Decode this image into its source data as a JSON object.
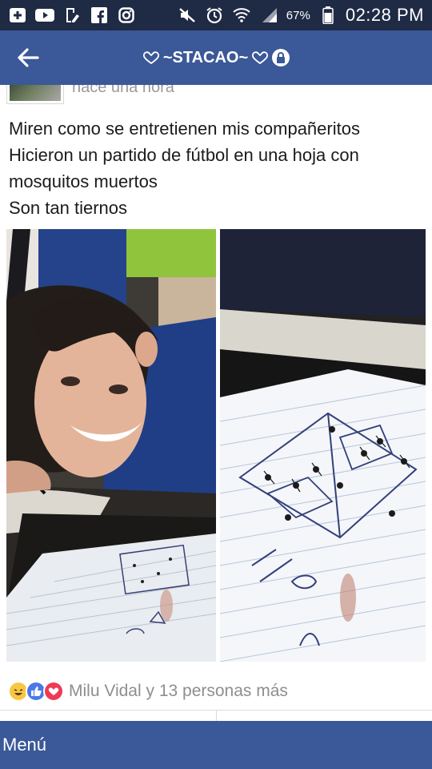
{
  "status_bar": {
    "time": "02:28 PM",
    "battery_percent": "67%",
    "icons_left": [
      "add-box-icon",
      "youtube-icon",
      "edit-doc-icon",
      "facebook-icon",
      "instagram-icon"
    ],
    "icons_right": [
      "mute-icon",
      "alarm-icon",
      "wifi-icon",
      "signal-icon",
      "battery-icon"
    ]
  },
  "app_bar": {
    "title": "~STACAO~",
    "back_icon": "arrow-left-icon",
    "lock_icon": "lock-icon"
  },
  "post": {
    "time": "hace una hora",
    "lines": [
      "Miren como se entretienen mis compañeritos",
      "Hicieron un partido de fútbol en una hoja con",
      "mosquitos muertos",
      "Son tan tiernos"
    ],
    "reactions": [
      "haha",
      "like",
      "love"
    ],
    "reaction_summary": "Milu Vidal y 13 personas más"
  },
  "bottom_bar": {
    "menu_label": "Menú"
  },
  "colors": {
    "status_bar": "#1f2a45",
    "brand": "#3b5898",
    "text": "#1b1b1b",
    "muted": "#8e8e8e"
  }
}
